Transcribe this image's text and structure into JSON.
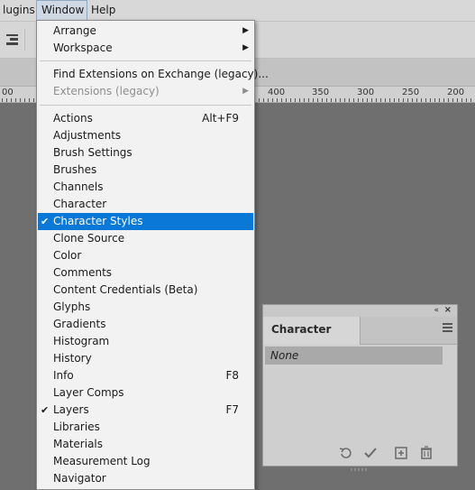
{
  "menubar": {
    "items": [
      {
        "label": "lugins"
      },
      {
        "label": "Window"
      },
      {
        "label": "Help"
      }
    ]
  },
  "ruler": {
    "labels": [
      "00",
      "400",
      "350",
      "300",
      "250",
      "200"
    ]
  },
  "window_menu": {
    "items": [
      {
        "label": "Arrange",
        "submenu": true
      },
      {
        "label": "Workspace",
        "submenu": true
      },
      {
        "label": "Find Extensions on Exchange (legacy)..."
      },
      {
        "label": "Extensions (legacy)",
        "submenu": true,
        "disabled": true
      },
      {
        "label": "Actions",
        "shortcut": "Alt+F9"
      },
      {
        "label": "Adjustments"
      },
      {
        "label": "Brush Settings"
      },
      {
        "label": "Brushes"
      },
      {
        "label": "Channels"
      },
      {
        "label": "Character"
      },
      {
        "label": "Character Styles",
        "checked": true,
        "selected": true
      },
      {
        "label": "Clone Source"
      },
      {
        "label": "Color"
      },
      {
        "label": "Comments"
      },
      {
        "label": "Content Credentials (Beta)"
      },
      {
        "label": "Glyphs"
      },
      {
        "label": "Gradients"
      },
      {
        "label": "Histogram"
      },
      {
        "label": "History"
      },
      {
        "label": "Info",
        "shortcut": "F8"
      },
      {
        "label": "Layer Comps"
      },
      {
        "label": "Layers",
        "shortcut": "F7",
        "checked": true
      },
      {
        "label": "Libraries"
      },
      {
        "label": "Materials"
      },
      {
        "label": "Measurement Log"
      },
      {
        "label": "Navigator"
      }
    ],
    "check_glyph": "✔",
    "arrow_glyph": "▶"
  },
  "panel": {
    "collapse_glyph": "«",
    "close_glyph": "×",
    "tab_label": "Character Styles",
    "rows": [
      {
        "label": "None"
      }
    ],
    "footer_icons": [
      "clear-override-icon",
      "redefine-style-icon",
      "new-style-icon",
      "delete-icon"
    ]
  },
  "colors": {
    "selection": "#0a78d7",
    "canvas": "#6f6f6f",
    "menu_bg": "#f2f2f2"
  }
}
